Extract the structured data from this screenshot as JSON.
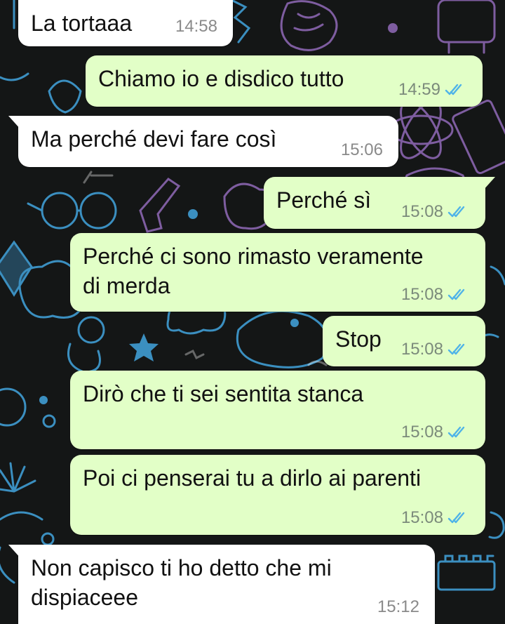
{
  "chat": {
    "messages": [
      {
        "direction": "incoming",
        "text": "La tortaaa",
        "time": "14:58"
      },
      {
        "direction": "outgoing",
        "text": "Chiamo io e disdico tutto",
        "time": "14:59",
        "status": "read"
      },
      {
        "direction": "incoming",
        "text": "Ma perché devi fare così",
        "time": "15:06"
      },
      {
        "direction": "outgoing",
        "text": "Perché sì",
        "time": "15:08",
        "status": "read"
      },
      {
        "direction": "outgoing",
        "text": "Perché ci sono rimasto veramente\ndi merda",
        "time": "15:08",
        "status": "read"
      },
      {
        "direction": "outgoing",
        "text": "Stop",
        "time": "15:08",
        "status": "read"
      },
      {
        "direction": "outgoing",
        "text": "Dirò che ti sei sentita stanca",
        "time": "15:08",
        "status": "read"
      },
      {
        "direction": "outgoing",
        "text": "Poi ci penserai tu a dirlo ai parenti",
        "time": "15:08",
        "status": "read"
      },
      {
        "direction": "incoming",
        "text": "Non capisco ti ho detto che mi\ndispiaceee",
        "time": "15:12"
      }
    ]
  },
  "colors": {
    "background": "#141616",
    "incoming_bubble": "#ffffff",
    "outgoing_bubble": "#e2ffc7",
    "read_tick": "#4fb3e8",
    "wallpaper_blue": "#3b8fc0",
    "wallpaper_purple": "#7e5da0"
  },
  "icons": {
    "read_status": "double-check-icon"
  }
}
